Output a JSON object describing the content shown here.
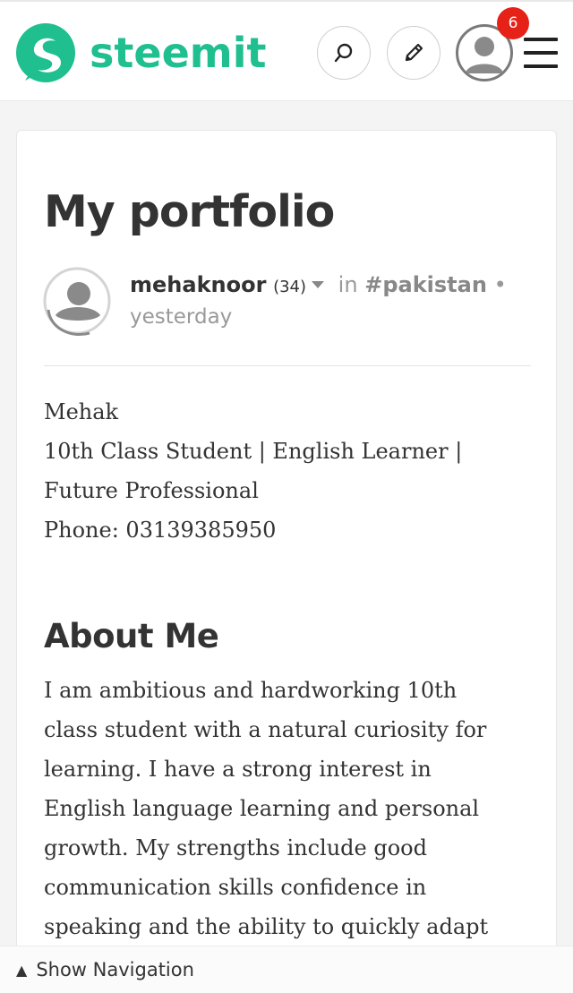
{
  "app": {
    "name": "steemit",
    "brand_color": "#1fbf8f",
    "notification_count": "6"
  },
  "header": {
    "search_icon": "search-icon",
    "compose_icon": "pencil-icon",
    "menu_icon": "hamburger-menu-icon"
  },
  "post": {
    "title": "My portfolio",
    "author": "mehaknoor",
    "reputation": "(34)",
    "in_label": "in",
    "category": "#pakistan",
    "separator": "•",
    "time": "yesterday",
    "bio_lines": [
      "Mehak",
      "10th Class Student | English Learner |",
      "Future Professional",
      "Phone: 03139385950"
    ],
    "section_heading": "About Me",
    "about_lines": [
      "I am ambitious and hardworking 10th",
      "class student with a natural curiosity for",
      "learning. I have a strong interest in",
      "English language learning and personal",
      "growth. My strengths include good",
      "communication skills confidence in",
      "speaking and the ability to quickly adapt"
    ]
  },
  "footer": {
    "arrow": "▲",
    "label": "Show Navigation"
  }
}
